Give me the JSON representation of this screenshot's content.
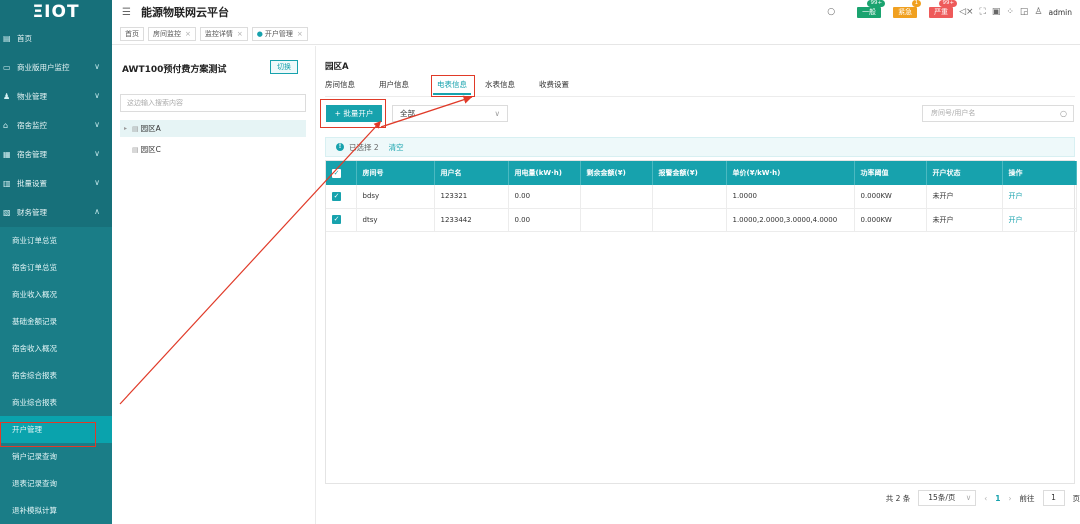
{
  "app": {
    "logo": "ΞIOT",
    "title": "能源物联网云平台",
    "menu_icon": "menu-fold-icon"
  },
  "header": {
    "alarms": [
      {
        "label": "一般",
        "count": "99+",
        "color": "#1aa36f"
      },
      {
        "label": "紧急",
        "count": "1",
        "color": "#f0a020"
      },
      {
        "label": "严重",
        "count": "99+",
        "color": "#ee5a5a"
      }
    ],
    "icons": [
      "search-icon",
      "mute-icon",
      "fullscreen-icon",
      "screen-icon",
      "grid-icon",
      "window-icon",
      "shirt-icon"
    ],
    "user": "admin"
  },
  "tabs": [
    {
      "label": "首页",
      "closable": false
    },
    {
      "label": "房间监控",
      "closable": true
    },
    {
      "label": "监控详情",
      "closable": true
    },
    {
      "label": "开户管理",
      "closable": true,
      "active": true
    }
  ],
  "sidebar": {
    "items": [
      {
        "label": "首页",
        "icon": "home-icon",
        "chev": ""
      },
      {
        "label": "商业版用户监控",
        "icon": "monitor-icon",
        "chev": "∨"
      },
      {
        "label": "物业管理",
        "icon": "user-icon",
        "chev": "∨"
      },
      {
        "label": "宿舍监控",
        "icon": "house-icon",
        "chev": "∨"
      },
      {
        "label": "宿舍管理",
        "icon": "building-icon",
        "chev": "∨"
      },
      {
        "label": "批量设置",
        "icon": "settings-icon",
        "chev": "∨"
      },
      {
        "label": "财务管理",
        "icon": "finance-icon",
        "chev": "∧"
      }
    ],
    "sub_items": [
      "商业订单总览",
      "宿舍订单总览",
      "商业收入概况",
      "基础金额记录",
      "宿舍收入概况",
      "宿舍综合报表",
      "商业综合报表",
      "开户管理",
      "销户记录查询",
      "退表记录查询",
      "退补模拟计算"
    ],
    "active_sub": "开户管理"
  },
  "tree": {
    "title": "AWT100预付费方案测试",
    "switch_label": "切换",
    "search_placeholder": "这边输入搜索内容",
    "nodes": [
      {
        "label": "园区A",
        "selected": true,
        "expandable": true
      },
      {
        "label": "园区C",
        "selected": false,
        "expandable": false
      }
    ]
  },
  "main": {
    "area_title": "园区A",
    "subtabs": [
      {
        "label": "房间信息",
        "active": false
      },
      {
        "label": "用户信息",
        "active": false
      },
      {
        "label": "电表信息",
        "active": true
      },
      {
        "label": "水表信息",
        "active": false
      },
      {
        "label": "收费设置",
        "active": false
      }
    ],
    "batch_button": "批量开户",
    "batch_icon": "plus-icon",
    "filter_value": "全部",
    "search_placeholder": "房间号/用户名",
    "selection": {
      "text": "已选择 2",
      "clear": "清空"
    },
    "table": {
      "columns": [
        "",
        "房间号",
        "用户名",
        "用电量(kW·h)",
        "剩余金额(¥)",
        "报警金额(¥)",
        "单价(¥/kW·h)",
        "功率阈值",
        "开户状态",
        "操作"
      ],
      "rows": [
        {
          "checked": true,
          "room": "bdsy",
          "user": "123321",
          "usage": "0.00",
          "balance": "",
          "alarm": "",
          "price": "1.0000",
          "power": "0.000KW",
          "status": "未开户",
          "op": "开户"
        },
        {
          "checked": true,
          "room": "dtsy",
          "user": "1233442",
          "usage": "0.00",
          "balance": "",
          "alarm": "",
          "price": "1.0000,2.0000,3.0000,4.0000",
          "power": "0.000KW",
          "status": "未开户",
          "op": "开户"
        }
      ]
    },
    "pager": {
      "total": "共 2 条",
      "page_size": "15条/页",
      "current": "1",
      "goto_label": "前往",
      "goto_value": "1",
      "page_unit": "页"
    }
  }
}
